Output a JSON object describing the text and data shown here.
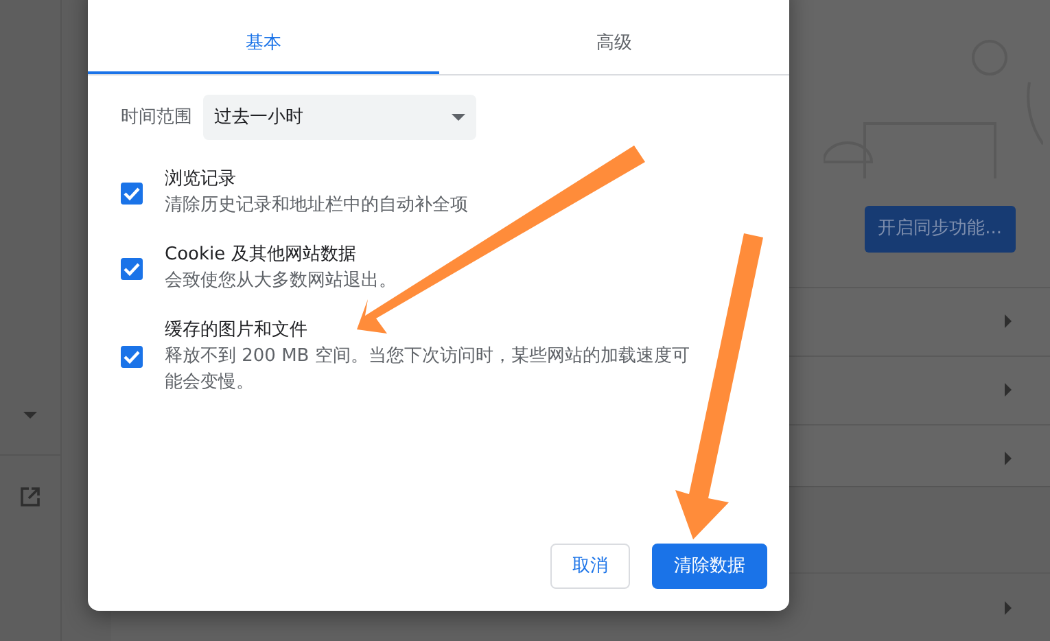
{
  "background": {
    "sync_button": "开启同步功能..."
  },
  "dialog": {
    "tabs": [
      {
        "label": "基本",
        "selected": true
      },
      {
        "label": "高级",
        "selected": false
      }
    ],
    "time_range": {
      "label": "时间范围",
      "value": "过去一小时"
    },
    "items": [
      {
        "title": "浏览记录",
        "description": "清除历史记录和地址栏中的自动补全项",
        "checked": true
      },
      {
        "title": "Cookie 及其他网站数据",
        "description": "会致使您从大多数网站退出。",
        "checked": true
      },
      {
        "title": "缓存的图片和文件",
        "description": "释放不到 200 MB 空间。当您下次访问时，某些网站的加载速度可能会变慢。",
        "checked": true
      }
    ],
    "buttons": [
      {
        "label": "取消",
        "kind": "secondary"
      },
      {
        "label": "清除数据",
        "kind": "primary"
      }
    ]
  }
}
